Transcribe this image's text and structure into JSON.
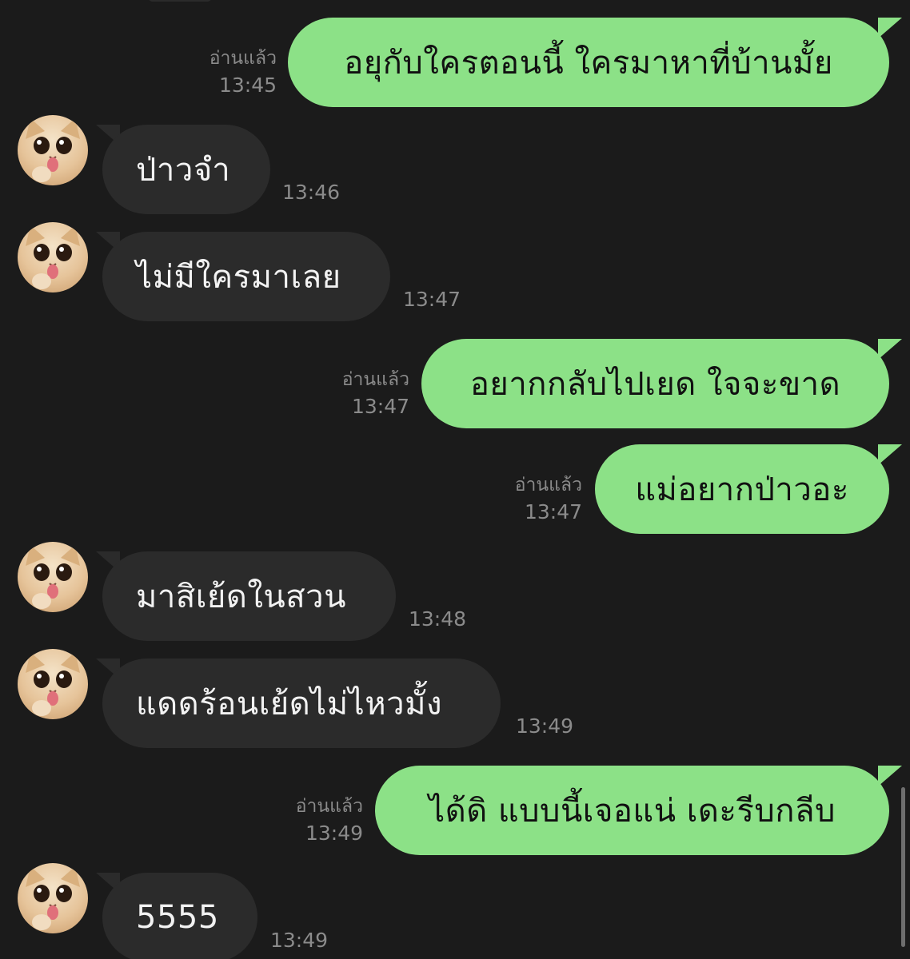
{
  "colors": {
    "background": "#1b1b1b",
    "outgoing_bubble": "#8ce187",
    "outgoing_text": "#111111",
    "incoming_bubble": "#2b2b2b",
    "incoming_text": "#f2f2f2",
    "meta_text": "#8b8b8b"
  },
  "messages": [
    {
      "direction": "out",
      "text": "อยุกับใครตอนนี้ ใครมาหาที่บ้านมั้ย",
      "read": "อ่านแล้ว",
      "time": "13:45"
    },
    {
      "direction": "in",
      "avatar": "cat-avatar",
      "text": "ป่าวจำ",
      "time": "13:46"
    },
    {
      "direction": "in",
      "avatar": "cat-avatar",
      "text": "ไม่มีใครมาเลย",
      "time": "13:47"
    },
    {
      "direction": "out",
      "text": "อยากกลับไปเยด ใจจะขาด",
      "read": "อ่านแล้ว",
      "time": "13:47"
    },
    {
      "direction": "out",
      "text": "แม่อยากป่าวอะ",
      "read": "อ่านแล้ว",
      "time": "13:47"
    },
    {
      "direction": "in",
      "avatar": "cat-avatar",
      "text": "มาสิเย้ดในสวน",
      "time": "13:48"
    },
    {
      "direction": "in",
      "avatar": "cat-avatar",
      "text": "แดดร้อนเย้ดไม่ไหวมั้ง",
      "time": "13:49"
    },
    {
      "direction": "out",
      "text": "ได้ดิ แบบนี้เจอแน่ เดะรีบกลีบ",
      "read": "อ่านแล้ว",
      "time": "13:49"
    },
    {
      "direction": "in",
      "avatar": "cat-avatar",
      "text": "5555",
      "time": "13:49"
    }
  ]
}
